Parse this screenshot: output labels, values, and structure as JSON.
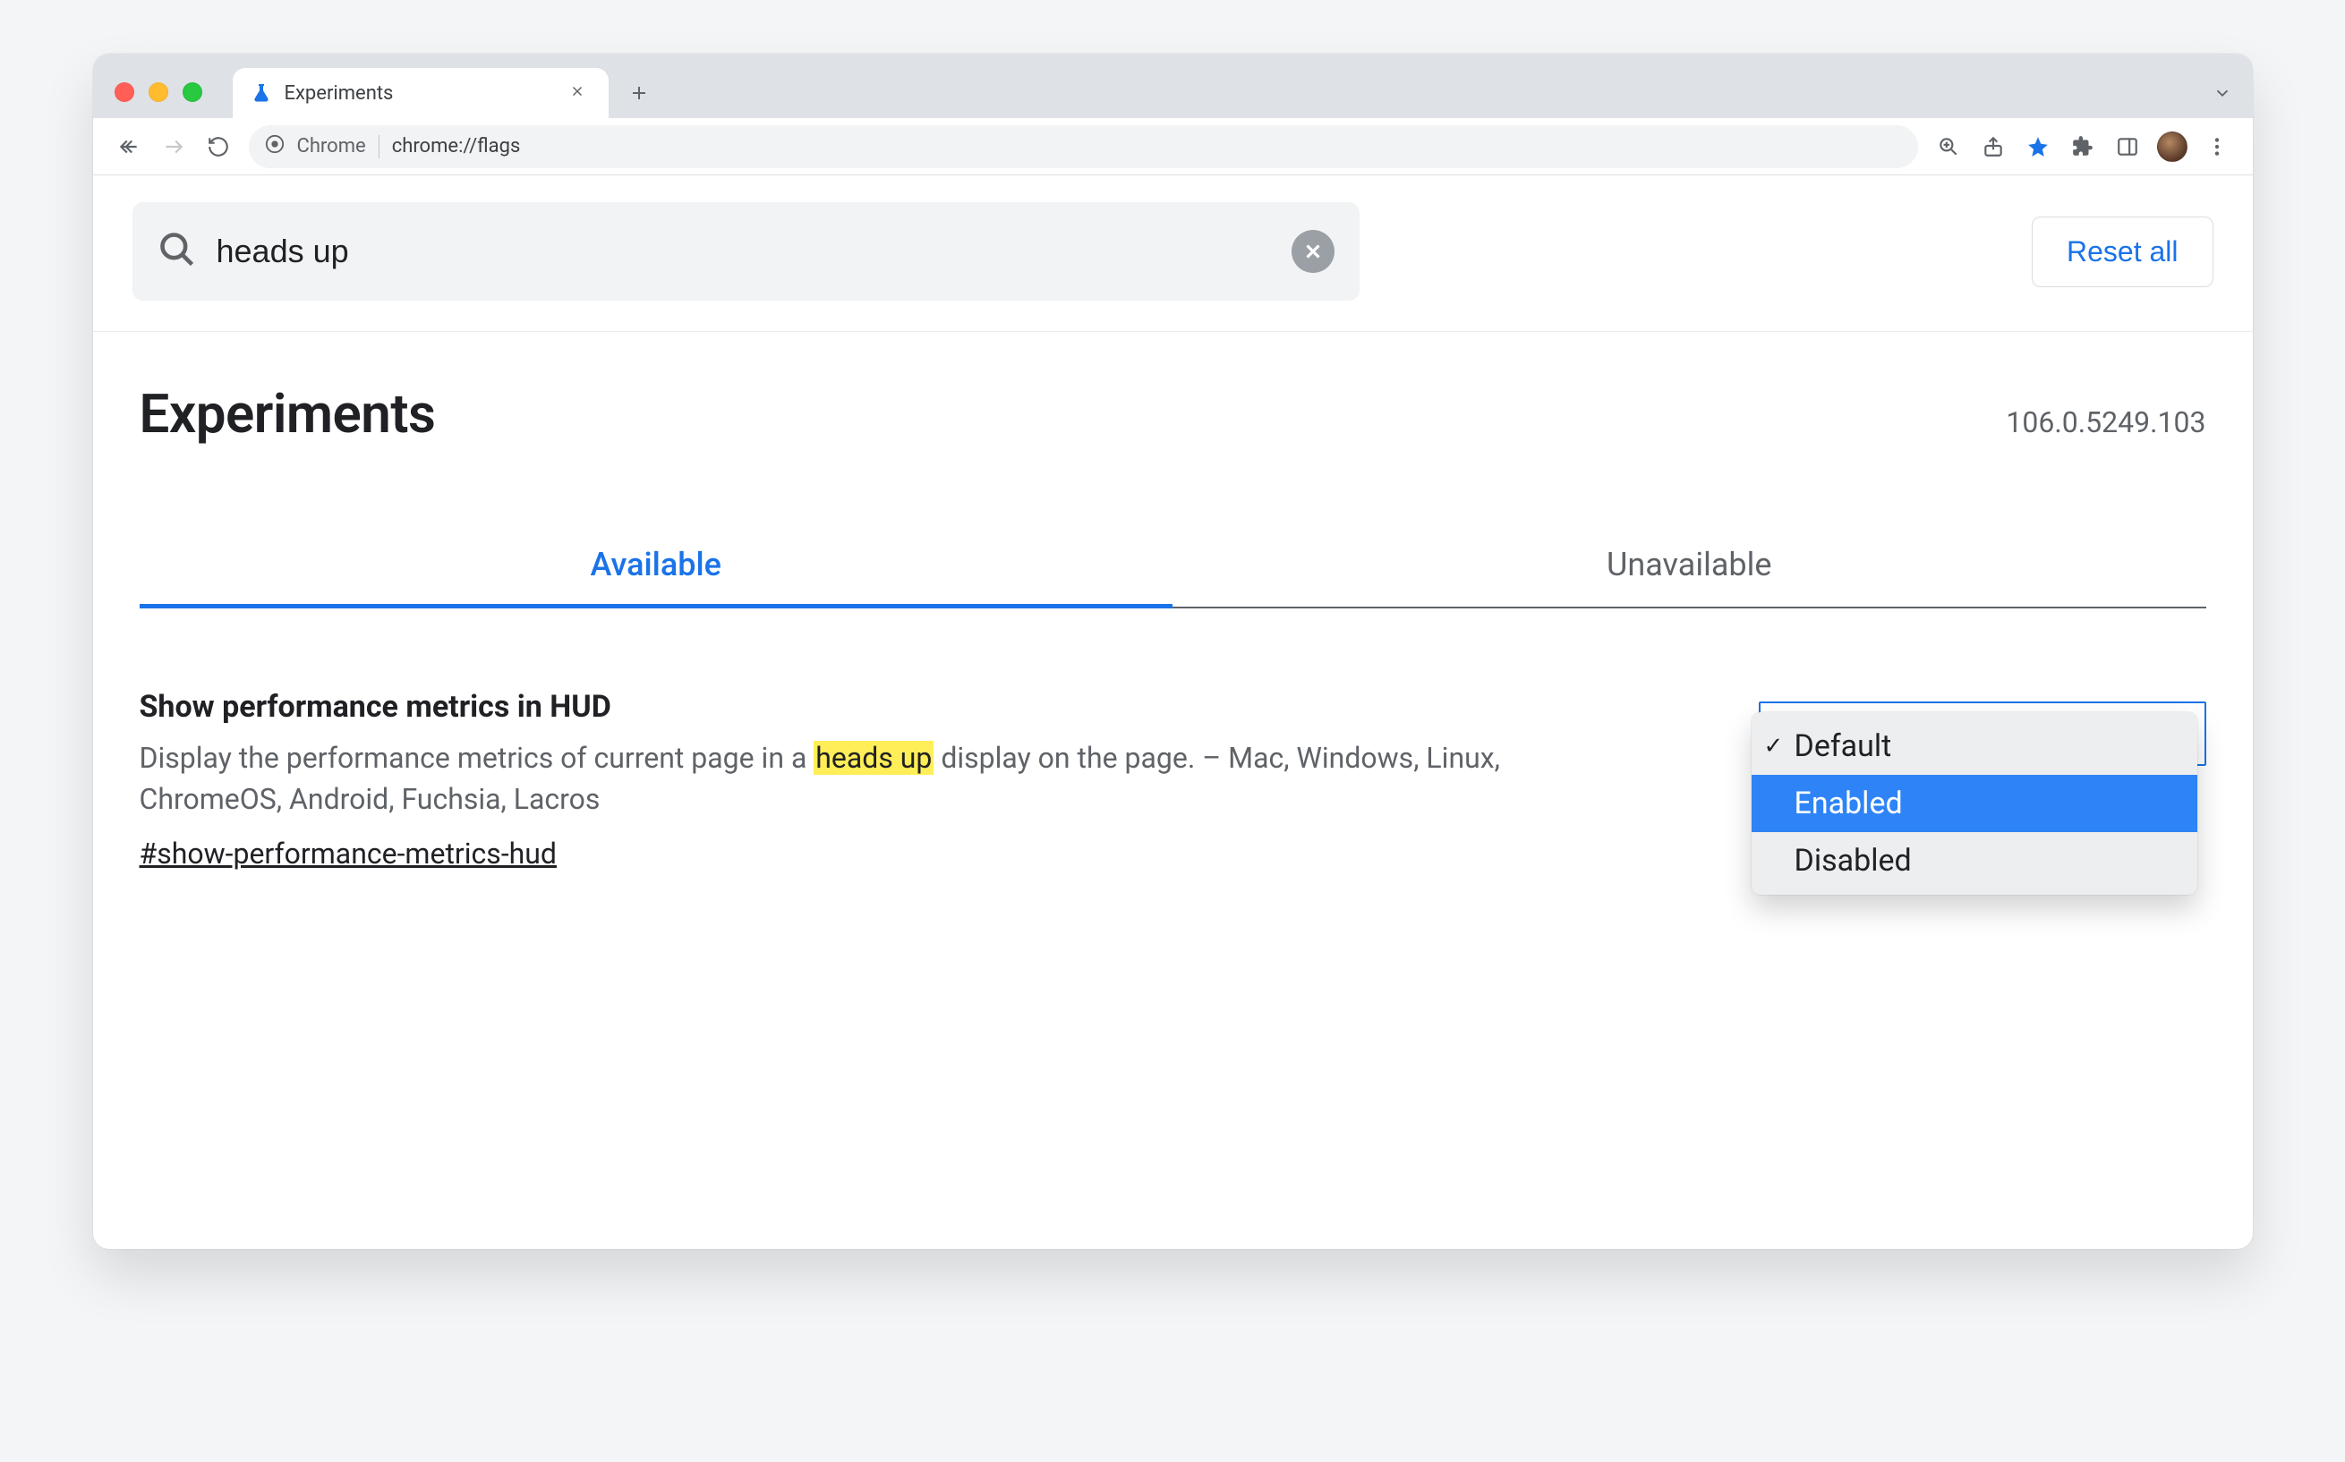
{
  "browser": {
    "tab_title": "Experiments",
    "omnibox_label": "Chrome",
    "omnibox_url": "chrome://flags"
  },
  "search": {
    "value": "heads up"
  },
  "reset_label": "Reset all",
  "page_title": "Experiments",
  "version": "106.0.5249.103",
  "tabs": {
    "available": "Available",
    "unavailable": "Unavailable"
  },
  "flag": {
    "title": "Show performance metrics in HUD",
    "desc_pre": "Display the performance metrics of current page in a ",
    "desc_hl": "heads up",
    "desc_post": " display on the page. – Mac, Windows, Linux, ChromeOS, Android, Fuchsia, Lacros",
    "anchor": "#show-performance-metrics-hud"
  },
  "dropdown": {
    "options": {
      "default": "Default",
      "enabled": "Enabled",
      "disabled": "Disabled"
    },
    "current": "Default",
    "highlighted": "Enabled"
  }
}
